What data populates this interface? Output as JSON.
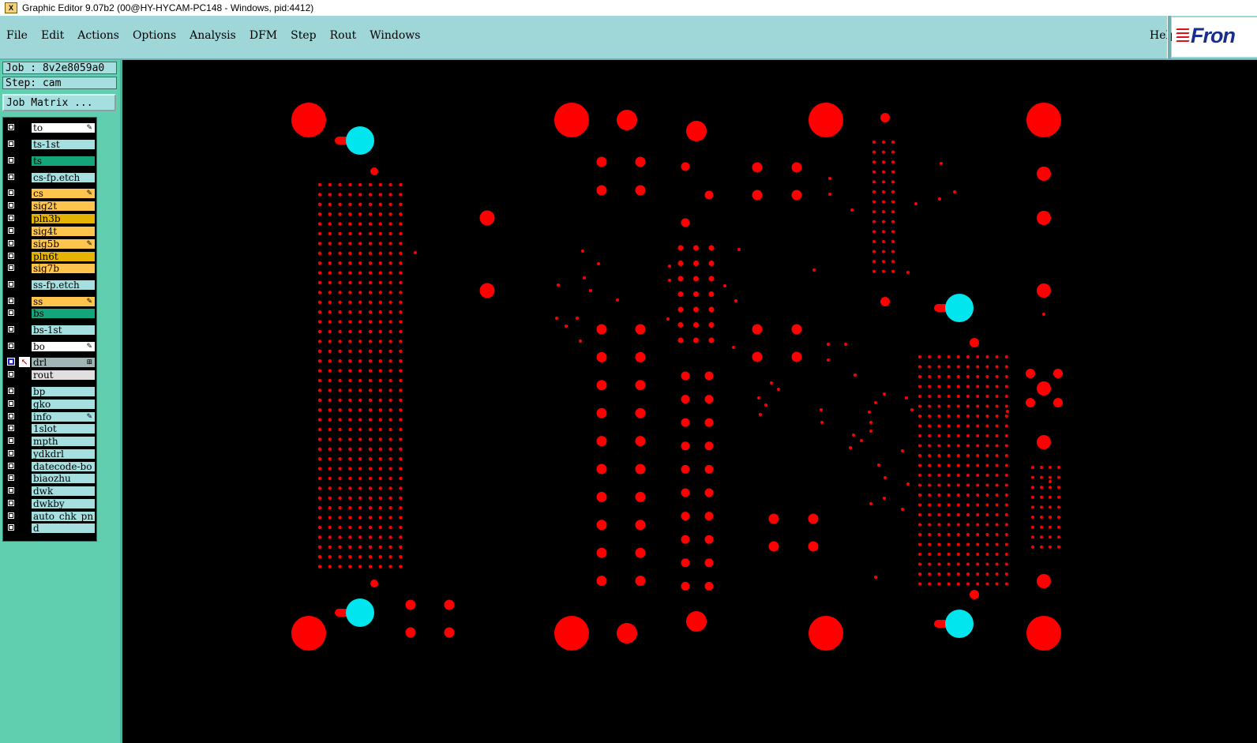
{
  "window": {
    "title": "Graphic Editor 9.07b2 (00@HY-HYCAM-PC148 - Windows, pid:4412)"
  },
  "menu": [
    "File",
    "Edit",
    "Actions",
    "Options",
    "Analysis",
    "DFM",
    "Step",
    "Rout",
    "Windows"
  ],
  "help_label": "Help",
  "logo_text": "Fron",
  "job": {
    "label": "Job : 8v2e8059a0"
  },
  "step": {
    "label": "Step: cam"
  },
  "job_matrix_label": "Job Matrix ...",
  "layers": [
    {
      "name": "to",
      "color": "white",
      "mark": "✎"
    },
    {
      "name": "ts-1st",
      "color": "cyan",
      "mark": ""
    },
    {
      "name": "ts",
      "color": "green",
      "mark": ""
    },
    {
      "name": "cs-fp.etch",
      "color": "cyan",
      "mark": ""
    },
    {
      "name": "cs",
      "color": "orange",
      "mark": "✎"
    },
    {
      "name": "sig2t",
      "color": "orange",
      "mark": ""
    },
    {
      "name": "pln3b",
      "color": "darkgold",
      "mark": ""
    },
    {
      "name": "sig4t",
      "color": "orange",
      "mark": ""
    },
    {
      "name": "sig5b",
      "color": "orange",
      "mark": "✎"
    },
    {
      "name": "pln6t",
      "color": "darkgold",
      "mark": ""
    },
    {
      "name": "sig7b",
      "color": "orange",
      "mark": ""
    },
    {
      "name": "ss-fp.etch",
      "color": "cyan",
      "mark": ""
    },
    {
      "name": "ss",
      "color": "orange",
      "mark": "✎"
    },
    {
      "name": "bs",
      "color": "green",
      "mark": ""
    },
    {
      "name": "bs-1st",
      "color": "cyan",
      "mark": ""
    },
    {
      "name": "bo",
      "color": "white",
      "mark": "✎"
    },
    {
      "name": "drl",
      "color": "gray",
      "mark": "⊞",
      "active": true
    },
    {
      "name": "rout",
      "color": "lgray",
      "mark": ""
    },
    {
      "name": "bp",
      "color": "cyan",
      "mark": ""
    },
    {
      "name": "gko",
      "color": "cyan",
      "mark": ""
    },
    {
      "name": "info",
      "color": "cyan",
      "mark": "✎"
    },
    {
      "name": "1slot",
      "color": "cyan",
      "mark": ""
    },
    {
      "name": "mpth",
      "color": "cyan",
      "mark": ""
    },
    {
      "name": "ydkdrl",
      "color": "cyan",
      "mark": ""
    },
    {
      "name": "datecode-bo",
      "color": "cyan",
      "mark": ""
    },
    {
      "name": "biaozhu",
      "color": "cyan",
      "mark": ""
    },
    {
      "name": "dwk",
      "color": "cyan",
      "mark": ""
    },
    {
      "name": "dwkby",
      "color": "cyan",
      "mark": ""
    },
    {
      "name": "auto_chk_pn",
      "color": "cyan",
      "mark": ""
    },
    {
      "name": "d",
      "color": "cyan",
      "mark": ""
    }
  ],
  "colors": {
    "pad": "#ff0000",
    "fiducial": "#00e5ee",
    "background": "#000000"
  }
}
